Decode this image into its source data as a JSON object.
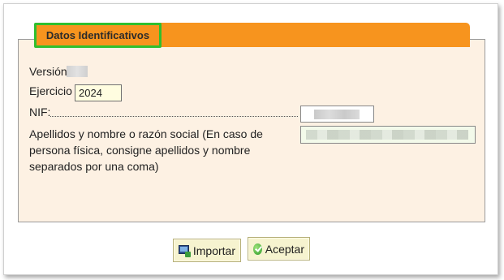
{
  "section": {
    "title": "Datos Identificativos"
  },
  "fields": {
    "version_label": "Versión",
    "ejercicio_label": "Ejercicio",
    "ejercicio_value": "2024",
    "nif_label": "NIF:",
    "nombre_label": "Apellidos y nombre o razón social (En caso de persona física, consigne apellidos y nombre separados por una coma)"
  },
  "buttons": {
    "import_label": "Importar",
    "accept_label": "Aceptar"
  },
  "colors": {
    "header": "#f7941e",
    "panel_bg": "#fdf1e3",
    "highlight": "#2fbf2f",
    "button_bg": "#f6f3cf"
  },
  "icons": {
    "import": "monitor-import-icon",
    "accept": "green-checkmark-icon"
  }
}
